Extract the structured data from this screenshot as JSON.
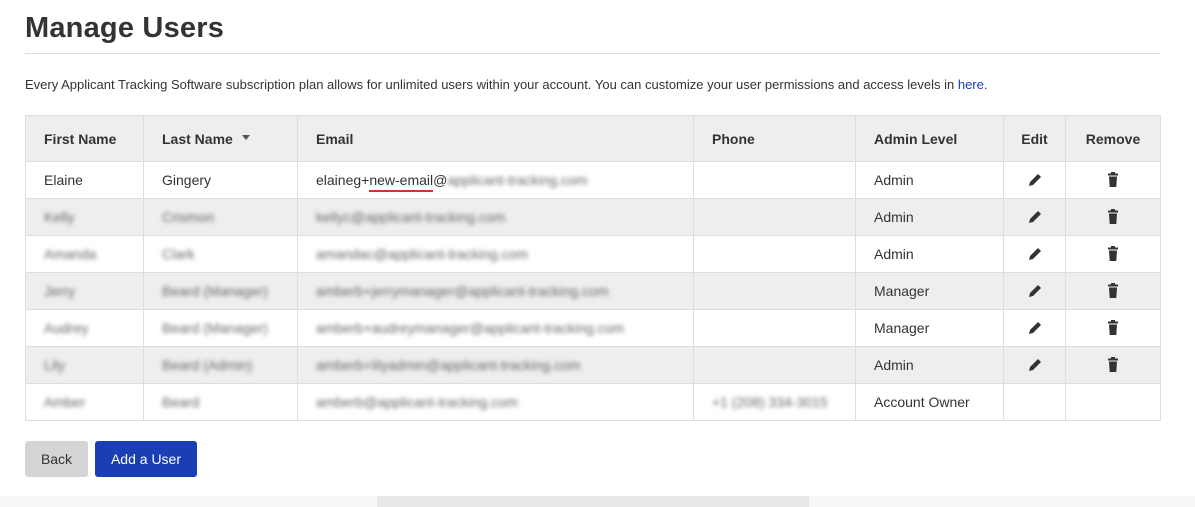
{
  "page": {
    "title": "Manage Users",
    "intro_text": "Every Applicant Tracking Software subscription plan allows for unlimited users within your account. You can customize your user permissions and access levels in ",
    "intro_link": "here",
    "intro_end": "."
  },
  "table": {
    "headers": {
      "first_name": "First Name",
      "last_name": "Last Name",
      "email": "Email",
      "phone": "Phone",
      "admin_level": "Admin Level",
      "edit": "Edit",
      "remove": "Remove"
    },
    "rows": [
      {
        "first": "Elaine",
        "last": "Gingery",
        "email_prefix": "elaineg+",
        "email_highlight": "new-email",
        "email_at": "@",
        "email_domain": "applicant-tracking.com",
        "phone": "",
        "level": "Admin",
        "editable": true
      },
      {
        "first": "Kelly",
        "last": "Crismon",
        "email": "kellyc@applicant-tracking.com",
        "phone": "",
        "level": "Admin",
        "editable": true
      },
      {
        "first": "Amanda",
        "last": "Clark",
        "email": "amandac@applicant-tracking.com",
        "phone": "",
        "level": "Admin",
        "editable": true
      },
      {
        "first": "Jerry",
        "last": "Beard (Manager)",
        "email": "amberb+jerrymanager@applicant-tracking.com",
        "phone": "",
        "level": "Manager",
        "editable": true
      },
      {
        "first": "Audrey",
        "last": "Beard (Manager)",
        "email": "amberb+audreymanager@applicant-tracking.com",
        "phone": "",
        "level": "Manager",
        "editable": true
      },
      {
        "first": "Lily",
        "last": "Beard (Admin)",
        "email": "amberb+lilyadmin@applicant-tracking.com",
        "phone": "",
        "level": "Admin",
        "editable": true
      },
      {
        "first": "Amber",
        "last": "Beard",
        "email": "amberb@applicant-tracking.com",
        "phone": "+1 (208) 334-3015",
        "level": "Account Owner",
        "editable": false
      }
    ]
  },
  "buttons": {
    "back": "Back",
    "add_user": "Add a User"
  },
  "colors": {
    "accent": "#1a3fb5",
    "underline": "#d4312b",
    "header_bg": "#eeeeee"
  },
  "icons": {
    "edit": "pencil-icon",
    "remove": "trash-icon",
    "sort": "caret-down-icon"
  }
}
